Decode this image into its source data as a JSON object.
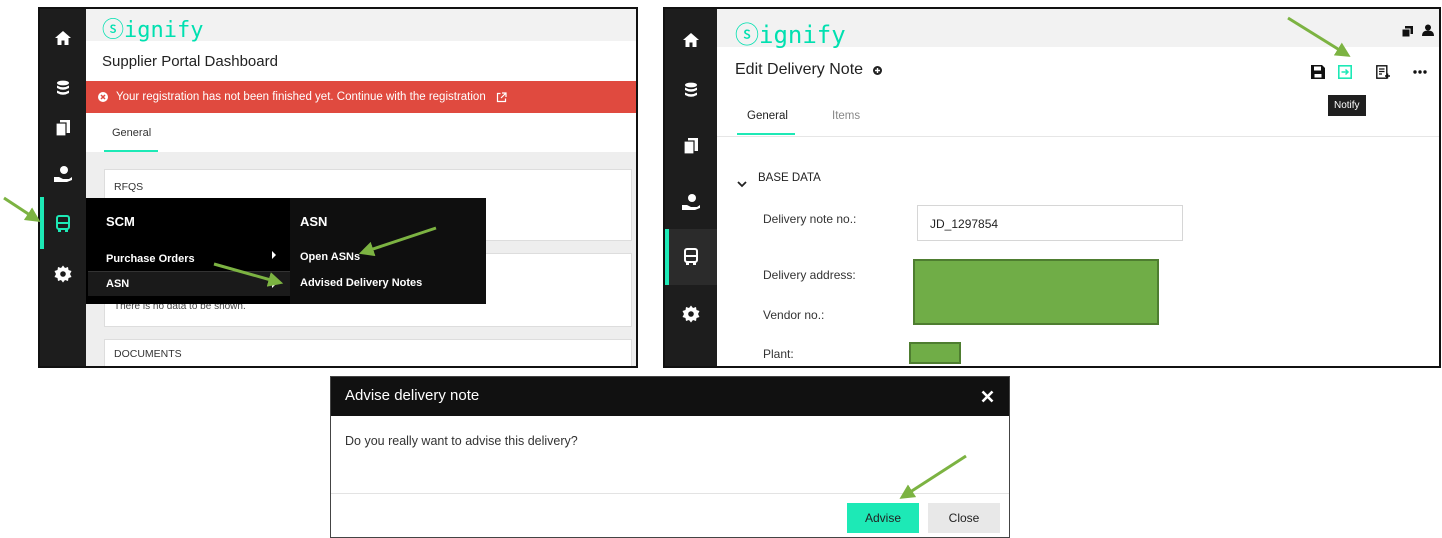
{
  "brand": {
    "logo": "ⓢignify",
    "accent": "#1de9b6",
    "error": "#e04a3f",
    "arrow": "#7cb342",
    "redacted": "#70ad47"
  },
  "p1": {
    "title": "Supplier Portal Dashboard",
    "alert": "Your registration has not been finished yet. Continue with the registration",
    "tab": "General",
    "rfqs": "RFQS",
    "nodata": "There is no data to be shown.",
    "documents": "DOCUMENTS",
    "menu": {
      "heading": "SCM",
      "items": [
        "Purchase Orders",
        "ASN"
      ],
      "sub_heading": "ASN",
      "sub_items": [
        "Open ASNs",
        "Advised Delivery Notes"
      ]
    }
  },
  "p2": {
    "title": "Edit Delivery Note",
    "tabs": [
      "General",
      "Items"
    ],
    "tooltip": "Notify",
    "section": "BASE DATA",
    "fields": {
      "delivery_note_label": "Delivery note no.:",
      "delivery_note_value": "JD_1297854",
      "delivery_address_label": "Delivery address:",
      "vendor_label": "Vendor no.:",
      "plant_label": "Plant:"
    }
  },
  "dialog": {
    "title": "Advise delivery note",
    "message": "Do you really want to advise this delivery?",
    "advise": "Advise",
    "close": "Close"
  }
}
